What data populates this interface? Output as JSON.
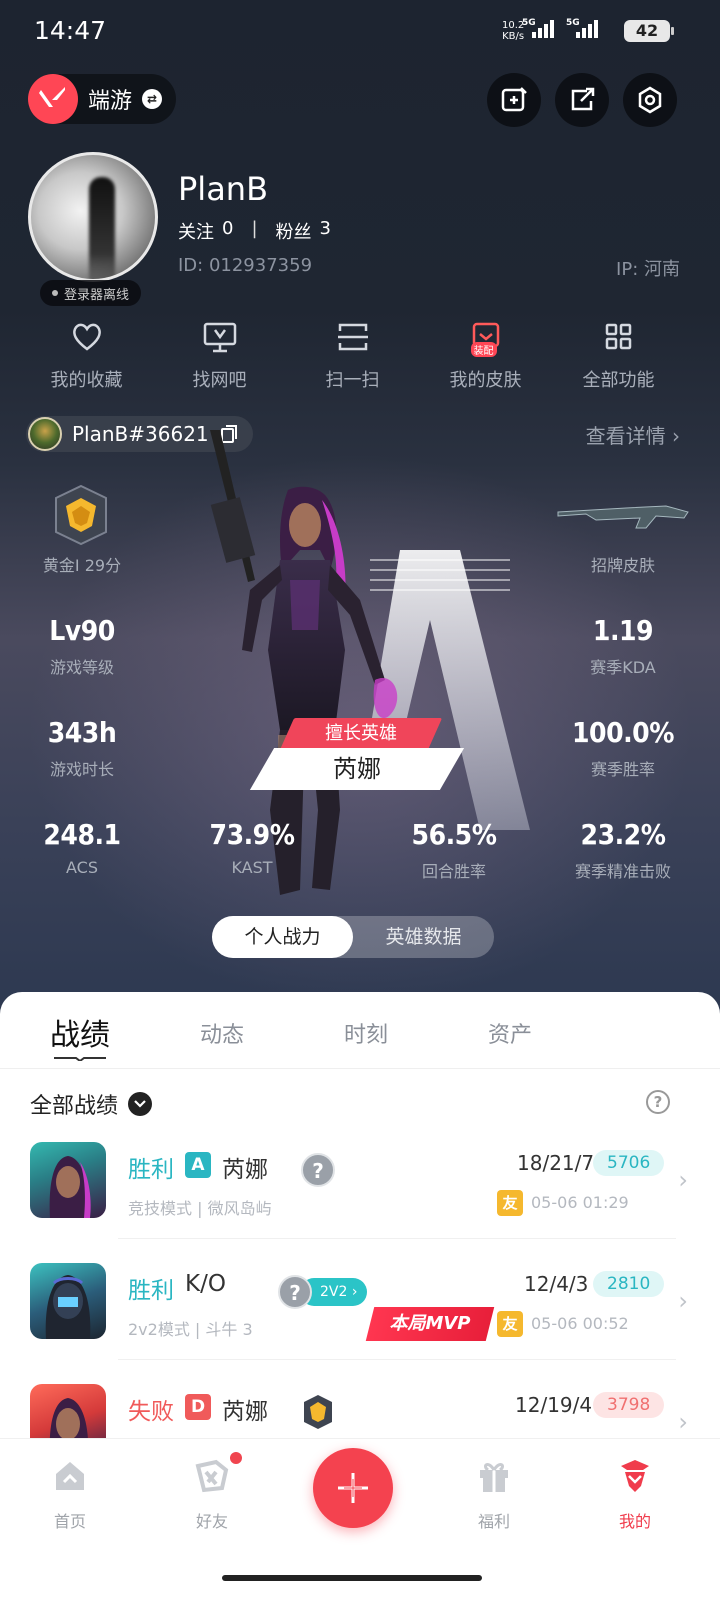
{
  "status_bar": {
    "time": "14:47",
    "net_speed": "10.2",
    "net_unit": "KB/s",
    "sig1": "5G",
    "sig2": "5G",
    "battery": "42"
  },
  "header": {
    "game_name": "端游"
  },
  "profile": {
    "username": "PlanB",
    "follow_label": "关注",
    "follow_count": "0",
    "fans_label": "粉丝",
    "fans_count": "3",
    "id_text": "ID: 012937359",
    "ip_text": "IP: 河南",
    "login_status": "登录器离线"
  },
  "quick_menu": [
    {
      "label": "我的收藏",
      "icon": "heart-icon"
    },
    {
      "label": "找网吧",
      "icon": "monitor-icon"
    },
    {
      "label": "扫一扫",
      "icon": "scan-icon"
    },
    {
      "label": "我的皮肤",
      "icon": "skin-icon",
      "badge": "装配"
    },
    {
      "label": "全部功能",
      "icon": "grid-icon"
    }
  ],
  "riot": {
    "id": "PlanB#36621",
    "view_detail": "查看详情"
  },
  "stats": {
    "rank": "黄金I 29分",
    "skin_label": "招牌皮肤",
    "level_val": "Lv90",
    "level_label": "游戏等级",
    "kda_val": "1.19",
    "kda_label": "赛季KDA",
    "hours_val": "343h",
    "hours_label": "游戏时长",
    "winrate_val": "100.0%",
    "winrate_label": "赛季胜率",
    "acs_val": "248.1",
    "acs_label": "ACS",
    "kast_val": "73.9%",
    "kast_label": "KAST",
    "round_val": "56.5%",
    "round_label": "回合胜率",
    "hs_val": "23.2%",
    "hs_label": "赛季精准击败"
  },
  "hero": {
    "tag": "擅长英雄",
    "name": "芮娜"
  },
  "toggle": {
    "personal": "个人战力",
    "agent_data": "英雄数据"
  },
  "tabs": [
    "战绩",
    "动态",
    "时刻",
    "资产"
  ],
  "filter": {
    "label": "全部战绩"
  },
  "matches": [
    {
      "result": "胜利",
      "rank": "A",
      "agent": "芮娜",
      "mode": "竞技模式 | 微风岛屿",
      "kda": "18/21/7",
      "score": "5706",
      "friend": "友",
      "time": "05-06 01:29"
    },
    {
      "result": "胜利",
      "rank": "",
      "agent": "K/O",
      "mode": "2v2模式 | 斗牛 3",
      "kda": "12/4/3",
      "score": "2810",
      "friend": "友",
      "time": "05-06 00:52",
      "tag": "2V2",
      "mvp": "本局MVP"
    },
    {
      "result": "失败",
      "rank": "D",
      "agent": "芮娜",
      "mode": "",
      "kda": "12/19/4",
      "score": "3798",
      "friend": "",
      "time": ""
    }
  ],
  "bottom_nav": [
    {
      "label": "首页",
      "icon": "home-icon"
    },
    {
      "label": "好友",
      "icon": "friends-icon"
    },
    {
      "label": "福利",
      "icon": "gift-icon"
    },
    {
      "label": "我的",
      "icon": "me-icon"
    }
  ],
  "colors": {
    "accent": "#f4424f",
    "win": "#2ab6c2",
    "lose": "#f05a5a"
  }
}
